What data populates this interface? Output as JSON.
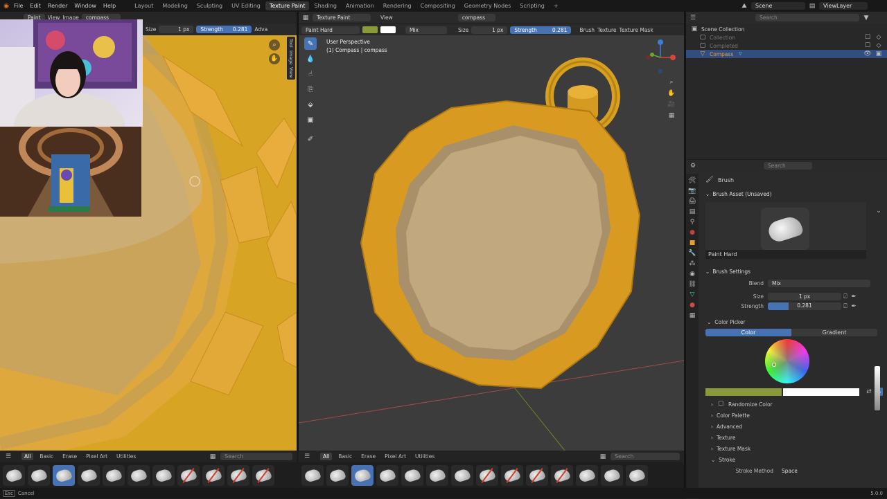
{
  "menu": {
    "items": [
      "File",
      "Edit",
      "Render",
      "Window",
      "Help"
    ]
  },
  "workspaces": {
    "tabs": [
      "Layout",
      "Modeling",
      "Sculpting",
      "UV Editing",
      "Texture Paint",
      "Shading",
      "Animation",
      "Rendering",
      "Compositing",
      "Geometry Nodes",
      "Scripting"
    ],
    "active": "Texture Paint",
    "add": "+"
  },
  "scene": {
    "label": "Scene",
    "view_layer": "ViewLayer"
  },
  "image_editor": {
    "mode": "Paint",
    "view": "View",
    "image": "Image",
    "image_name": "compass",
    "size_label": "Size",
    "size_value": "1 px",
    "strength_label": "Strength",
    "strength_value": "0.281",
    "adv": "Adva",
    "side_tabs": [
      "Tool",
      "Image",
      "View"
    ]
  },
  "viewport": {
    "mode": "Texture Paint",
    "view": "View",
    "object": "compass",
    "brush": "Paint Hard",
    "blend": "Mix",
    "size_label": "Size",
    "size_value": "1 px",
    "strength_label": "Strength",
    "strength_value": "0.281",
    "menus": [
      "Brush",
      "Texture",
      "Texture Mask"
    ],
    "perspective": "User Perspective",
    "object_info": "(1) Compass | compass",
    "color_primary": "#8a9a3a",
    "color_secondary": "#ffffff"
  },
  "outliner": {
    "search_placeholder": "Search",
    "items": [
      {
        "label": "Scene Collection"
      },
      {
        "label": "Collection"
      },
      {
        "label": "Completed"
      },
      {
        "label": "Compass"
      }
    ]
  },
  "properties": {
    "search_placeholder": "Search",
    "context": "Brush",
    "asset_header": "Brush Asset (Unsaved)",
    "asset_name": "Paint Hard",
    "settings_header": "Brush Settings",
    "blend_label": "Blend",
    "blend_value": "Mix",
    "size_label": "Size",
    "size_value": "1 px",
    "strength_label": "Strength",
    "strength_value": "0.281",
    "strength_fraction": 0.281,
    "color_picker": "Color Picker",
    "color_tab": "Color",
    "gradient_tab": "Gradient",
    "randomize": "Randomize Color",
    "panels": [
      "Color Palette",
      "Advanced",
      "Texture",
      "Texture Mask",
      "Stroke"
    ],
    "stroke_method_label": "Stroke Method",
    "stroke_method_value": "Space"
  },
  "shelf": {
    "tabs": [
      "All",
      "Basic",
      "Erase",
      "Pixel Art",
      "Utilities"
    ],
    "search_placeholder": "Search"
  },
  "status": {
    "key": "Esc",
    "action": "Cancel",
    "version": "5.0.0"
  }
}
